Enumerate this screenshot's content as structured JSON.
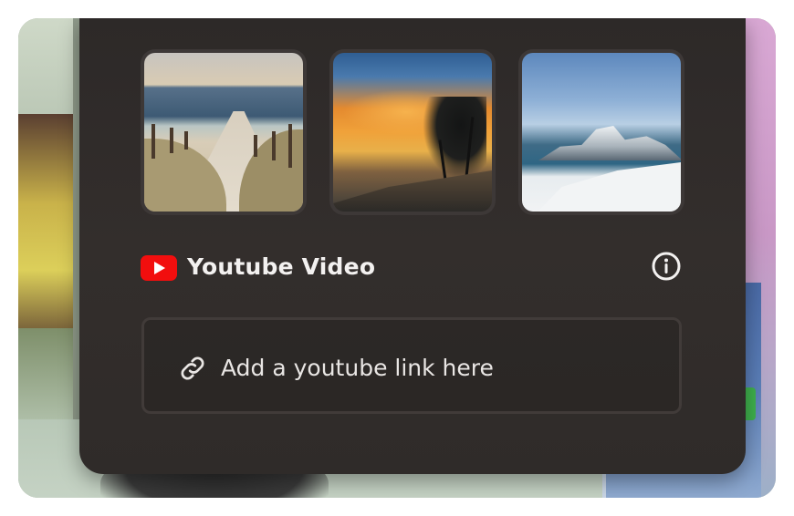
{
  "thumbnails": [
    {
      "name": "Beach path with fence"
    },
    {
      "name": "Tropical sunset with palms"
    },
    {
      "name": "Snowy fjord mountains"
    }
  ],
  "video": {
    "title": "Youtube Video",
    "logo_icon": "youtube-play-icon",
    "info_icon": "info-circle-icon",
    "brand_color": "#f20e0e"
  },
  "link_input": {
    "placeholder": "Add a youtube link here",
    "icon": "link-icon"
  }
}
